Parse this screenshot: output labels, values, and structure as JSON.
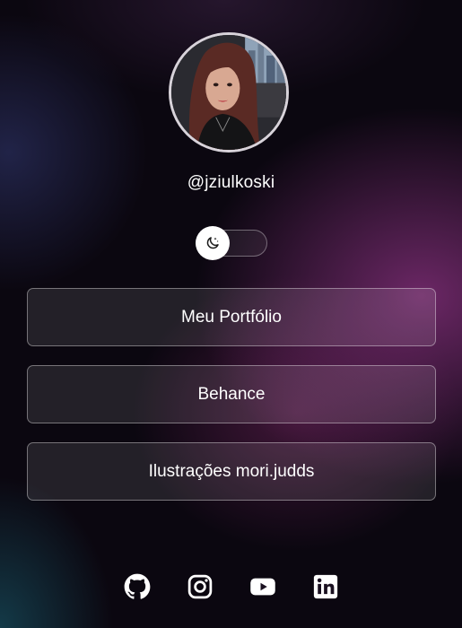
{
  "profile": {
    "handle": "@jziulkoski",
    "avatar_icon": "profile-photo"
  },
  "theme_toggle": {
    "icon": "moon-icon",
    "state": "dark"
  },
  "links": [
    {
      "label": "Meu Portfólio"
    },
    {
      "label": "Behance"
    },
    {
      "label": "Ilustrações mori.judds"
    }
  ],
  "social": [
    {
      "icon": "github-icon"
    },
    {
      "icon": "instagram-icon"
    },
    {
      "icon": "youtube-icon"
    },
    {
      "icon": "linkedin-icon"
    }
  ],
  "colors": {
    "background": "#0b0710",
    "accent_glow": "#8c3282",
    "text": "#ffffff"
  }
}
